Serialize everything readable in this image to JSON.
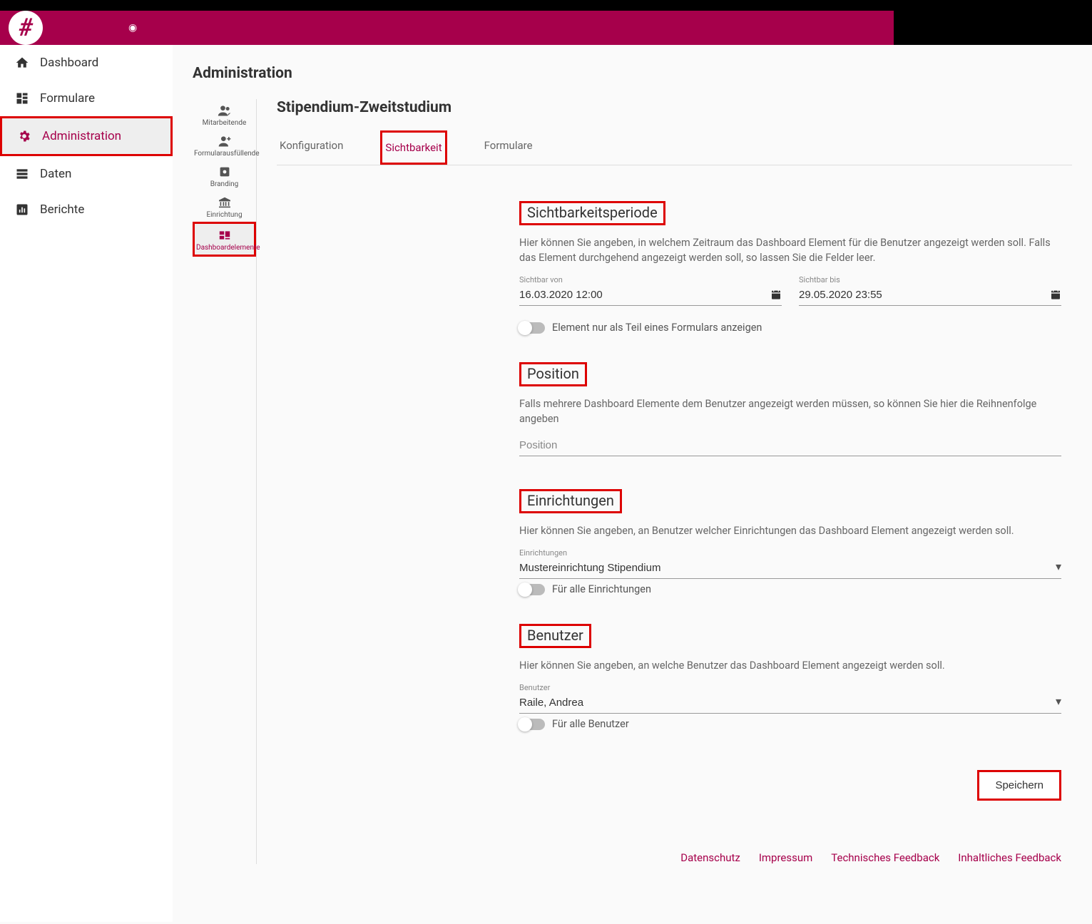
{
  "sidebar": {
    "items": [
      {
        "label": "Dashboard"
      },
      {
        "label": "Formulare"
      },
      {
        "label": "Administration"
      },
      {
        "label": "Daten"
      },
      {
        "label": "Berichte"
      }
    ]
  },
  "page_title": "Administration",
  "sub_sidebar": {
    "items": [
      {
        "label": "Mitarbeitende"
      },
      {
        "label": "Formularausfüllende"
      },
      {
        "label": "Branding"
      },
      {
        "label": "Einrichtung"
      },
      {
        "label": "Dashboardelemente"
      }
    ]
  },
  "section_title": "Stipendium-Zweitstudium",
  "tabs": [
    {
      "label": "Konfiguration"
    },
    {
      "label": "Sichtbarkeit"
    },
    {
      "label": "Formulare"
    }
  ],
  "visibility": {
    "heading": "Sichtbarkeitsperiode",
    "help": "Hier können Sie angeben, in welchem Zeitraum das Dashboard Element für die Benutzer angezeigt werden soll. Falls das Element durchgehend angezeigt werden soll, so lassen Sie die Felder leer.",
    "from_label": "Sichtbar von",
    "from_value": "16.03.2020 12:00",
    "to_label": "Sichtbar bis",
    "to_value": "29.05.2020 23:55",
    "toggle_label": "Element nur als Teil eines Formulars anzeigen"
  },
  "position": {
    "heading": "Position",
    "help": "Falls mehrere Dashboard Elemente dem Benutzer angezeigt werden müssen, so können Sie hier die Reihnenfolge angeben",
    "placeholder": "Position"
  },
  "einrichtungen": {
    "heading": "Einrichtungen",
    "help": "Hier können Sie angeben, an Benutzer welcher Einrichtungen das Dashboard Element angezeigt werden soll.",
    "label": "Einrichtungen",
    "value": "Mustereinrichtung Stipendium",
    "toggle_label": "Für alle Einrichtungen"
  },
  "benutzer": {
    "heading": "Benutzer",
    "help": "Hier können Sie angeben, an welche Benutzer das Dashboard Element angezeigt werden soll.",
    "label": "Benutzer",
    "value": "Raile, Andrea",
    "toggle_label": "Für alle Benutzer"
  },
  "save_label": "Speichern",
  "footer": {
    "datenschutz": "Datenschutz",
    "impressum": "Impressum",
    "tech_feedback": "Technisches Feedback",
    "inhalt_feedback": "Inhaltliches Feedback"
  }
}
